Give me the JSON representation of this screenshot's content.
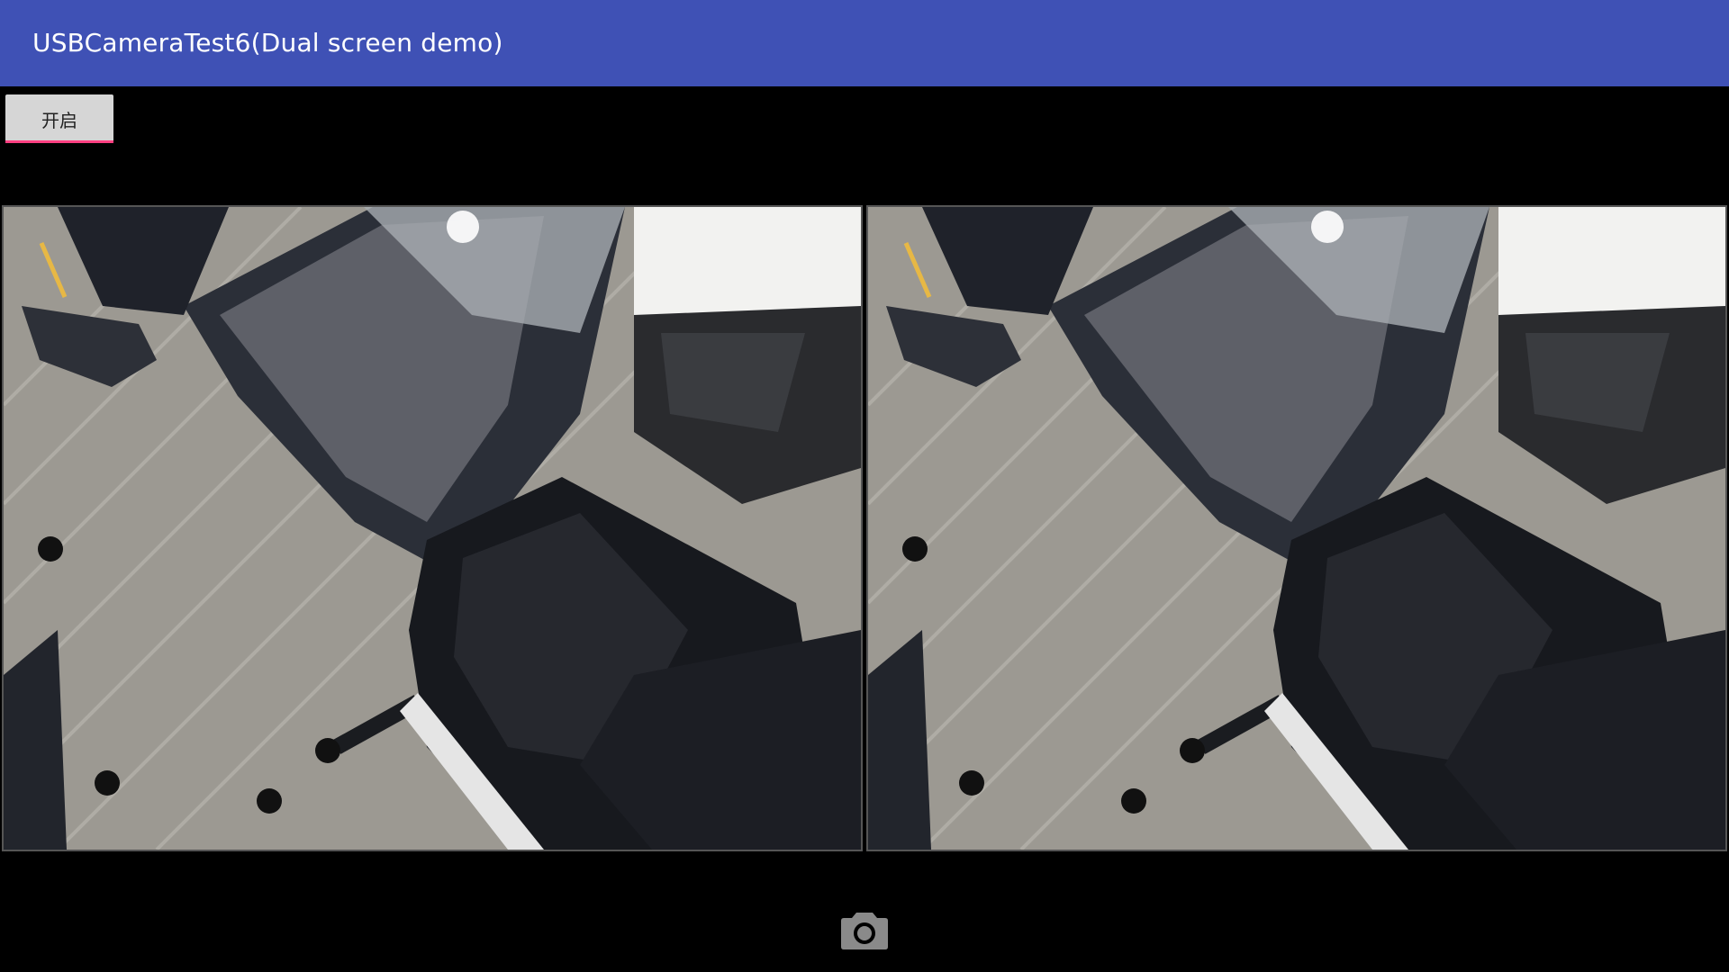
{
  "app_bar": {
    "title": "USBCameraTest6(Dual screen demo)",
    "color": "#3f51b5"
  },
  "controls": {
    "toggle_label": "开启",
    "toggle_accent": "#ff4081"
  },
  "camera_views": [
    {
      "name": "camera-preview-left"
    },
    {
      "name": "camera-preview-right"
    }
  ],
  "capture_button": {
    "icon": "camera-icon"
  }
}
